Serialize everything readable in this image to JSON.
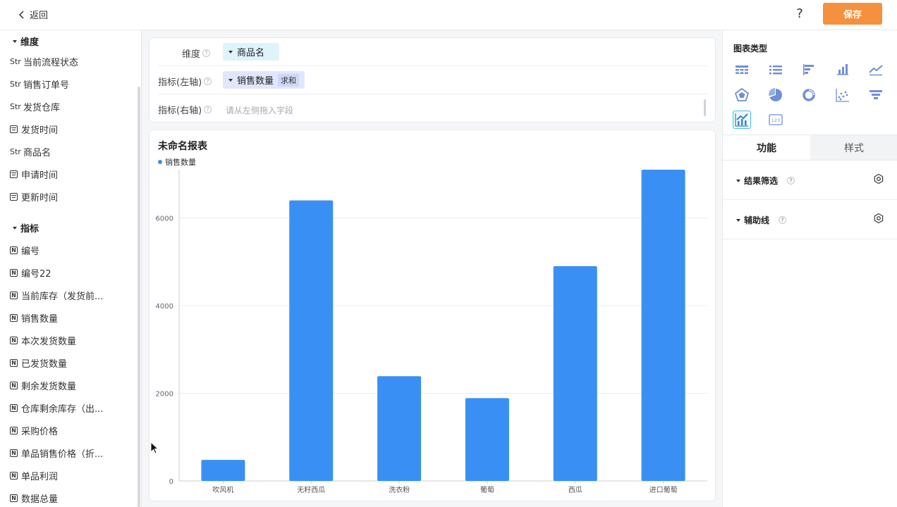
{
  "topbar": {
    "back_label": "返回",
    "help_label": "?",
    "save_label": "保存"
  },
  "sidebar": {
    "dimension_header": "维度",
    "dimensions": [
      {
        "type": "str",
        "type_label": "Str",
        "label": "当前流程状态"
      },
      {
        "type": "str",
        "type_label": "Str",
        "label": "销售订单号"
      },
      {
        "type": "str",
        "type_label": "Str",
        "label": "发货仓库"
      },
      {
        "type": "date",
        "type_label": "",
        "label": "发货时间"
      },
      {
        "type": "str",
        "type_label": "Str",
        "label": "商品名"
      },
      {
        "type": "date",
        "type_label": "",
        "label": "申请时间"
      },
      {
        "type": "date",
        "type_label": "",
        "label": "更新时间"
      }
    ],
    "metric_header": "指标",
    "metrics": [
      {
        "type_label": "N",
        "label": "编号"
      },
      {
        "type_label": "N",
        "label": "编号22"
      },
      {
        "type_label": "N",
        "label": "当前库存（发货前..."
      },
      {
        "type_label": "N",
        "label": "销售数量"
      },
      {
        "type_label": "N",
        "label": "本次发货数量"
      },
      {
        "type_label": "N",
        "label": "已发货数量"
      },
      {
        "type_label": "N",
        "label": "剩余发货数量"
      },
      {
        "type_label": "N",
        "label": "仓库剩余库存（出..."
      },
      {
        "type_label": "N",
        "label": "采购价格"
      },
      {
        "type_label": "N",
        "label": "单品销售价格（折..."
      },
      {
        "type_label": "N",
        "label": "单品利润"
      },
      {
        "type_label": "N",
        "label": "数据总量"
      }
    ]
  },
  "config": {
    "dimension_label": "维度",
    "dimension_value": "商品名",
    "left_axis_label": "指标(左轴)",
    "left_axis_value": "销售数量",
    "left_axis_agg": "求和",
    "right_axis_label": "指标(右轴)",
    "right_axis_placeholder": "请从左侧拖入字段",
    "help_glyph": "?"
  },
  "chart_data": {
    "type": "bar",
    "title": "未命名报表",
    "categories": [
      "吹风机",
      "无籽西瓜",
      "洗衣粉",
      "葡萄",
      "西瓜",
      "进口葡萄"
    ],
    "series": [
      {
        "name": "销售数量",
        "values": [
          480,
          6400,
          2390,
          1890,
          4900,
          7100
        ]
      }
    ],
    "ylim": [
      0,
      7100
    ],
    "yticks": [
      0,
      2000,
      4000,
      6000
    ],
    "grid": true,
    "legend_position": "top-left",
    "color": "#3a8ff5"
  },
  "right_panel": {
    "chart_type_title": "图表类型",
    "chart_types": [
      {
        "icon": "table-icon",
        "active": false
      },
      {
        "icon": "list-table-icon",
        "active": false
      },
      {
        "icon": "horizontal-bar-icon",
        "active": false
      },
      {
        "icon": "column-chart-icon",
        "active": false
      },
      {
        "icon": "line-chart-icon",
        "active": false
      },
      {
        "icon": "radar-chart-icon",
        "active": false
      },
      {
        "icon": "pie-chart-icon",
        "active": false
      },
      {
        "icon": "donut-chart-icon",
        "active": false
      },
      {
        "icon": "scatter-chart-icon",
        "active": false
      },
      {
        "icon": "funnel-chart-icon",
        "active": false
      },
      {
        "icon": "combo-chart-icon",
        "active": true
      },
      {
        "icon": "number-card-icon",
        "active": false
      }
    ],
    "tabs": [
      {
        "label": "功能",
        "active": true
      },
      {
        "label": "样式",
        "active": false
      }
    ],
    "sections": [
      {
        "label": "结果筛选"
      },
      {
        "label": "辅助线"
      }
    ],
    "icon_color": "#6f8fd8",
    "accent_color": "#49c3d6"
  }
}
